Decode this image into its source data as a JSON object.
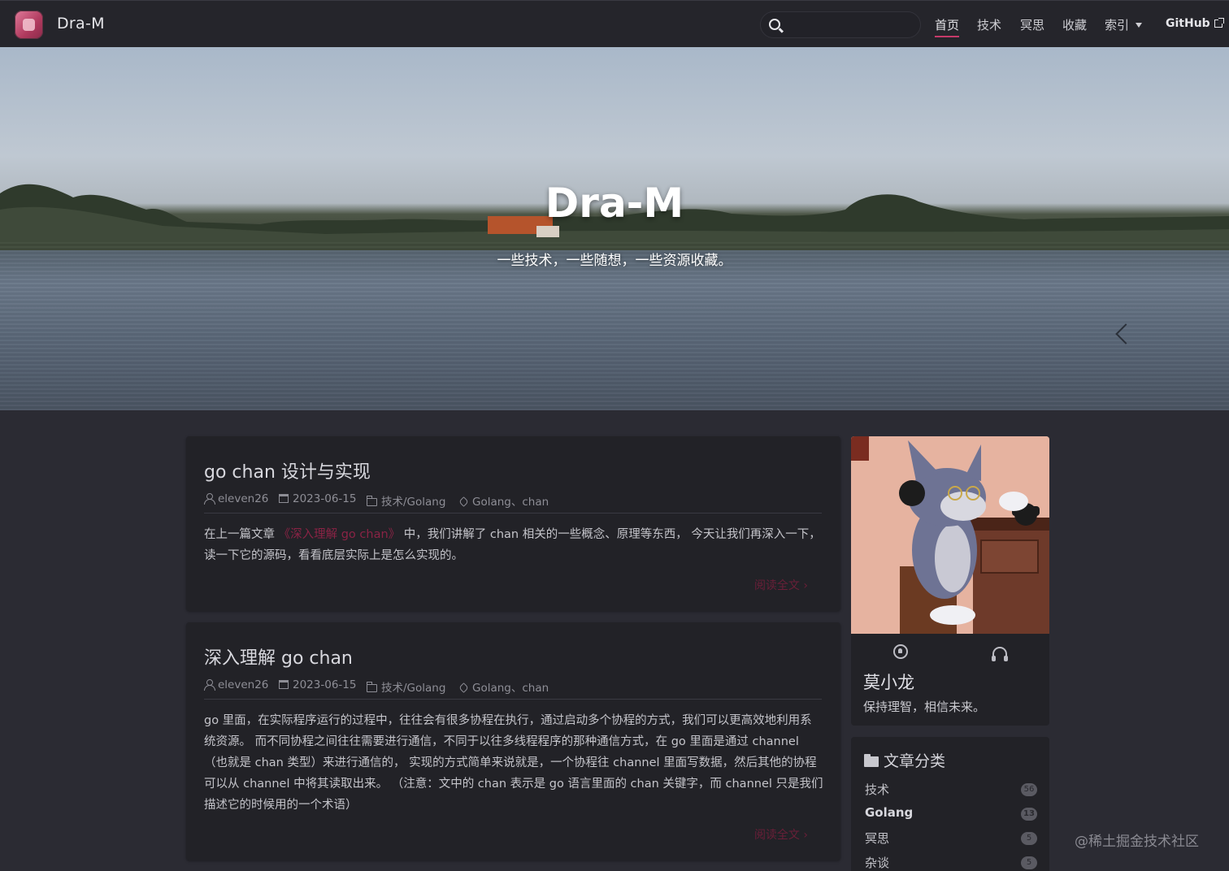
{
  "nav": {
    "brand": "Dra-M",
    "search_placeholder": "",
    "items": [
      {
        "label": "首页",
        "active": true
      },
      {
        "label": "技术"
      },
      {
        "label": "冥思"
      },
      {
        "label": "收藏"
      },
      {
        "label": "索引"
      }
    ],
    "github_label": "GitHub"
  },
  "hero": {
    "title": "Dra-M",
    "subtitle": "一些技术，一些随想，一些资源收藏。"
  },
  "posts": [
    {
      "title": "go chan 设计与实现",
      "author": "eleven26",
      "date": "2023-06-15",
      "category": "技术/Golang",
      "tags": "Golang、chan",
      "excerpt_before": "在上一篇文章 ",
      "excerpt_link": "《深入理解 go chan》",
      "excerpt_after": " 中，我们讲解了 chan 相关的一些概念、原理等东西， 今天让我们再深入一下，读一下它的源码，看看底层实际上是怎么实现的。",
      "read_more": "阅读全文 ›"
    },
    {
      "title": "深入理解 go chan",
      "author": "eleven26",
      "date": "2023-06-15",
      "category": "技术/Golang",
      "tags": "Golang、chan",
      "excerpt": "go 里面，在实际程序运行的过程中，往往会有很多协程在执行，通过启动多个协程的方式，我们可以更高效地利用系统资源。 而不同协程之间往往需要进行通信，不同于以往多线程程序的那种通信方式，在 go 里面是通过 channel （也就是 chan 类型）来进行通信的， 实现的方式简单来说就是，一个协程往 channel 里面写数据，然后其他的协程可以从 channel 中将其读取出来。 （注意：文中的 chan 表示是 go 语言里面的 chan 关键字，而 channel 只是我们描述它的时候用的一个术语）",
      "read_more": "阅读全文 ›"
    }
  ],
  "profile": {
    "name": "莫小龙",
    "motto": "保持理智，相信未来。"
  },
  "categories": {
    "heading": "文章分类",
    "items": [
      {
        "label": "技术",
        "count": "56"
      },
      {
        "label": "Golang",
        "count": "13"
      },
      {
        "label": "冥思",
        "count": "5"
      },
      {
        "label": "杂谈",
        "count": "5"
      }
    ]
  },
  "watermark": "@稀土掘金技术社区",
  "colors": {
    "accent": "#c63a6a",
    "background": "#2b2b33",
    "card": "#222227"
  }
}
